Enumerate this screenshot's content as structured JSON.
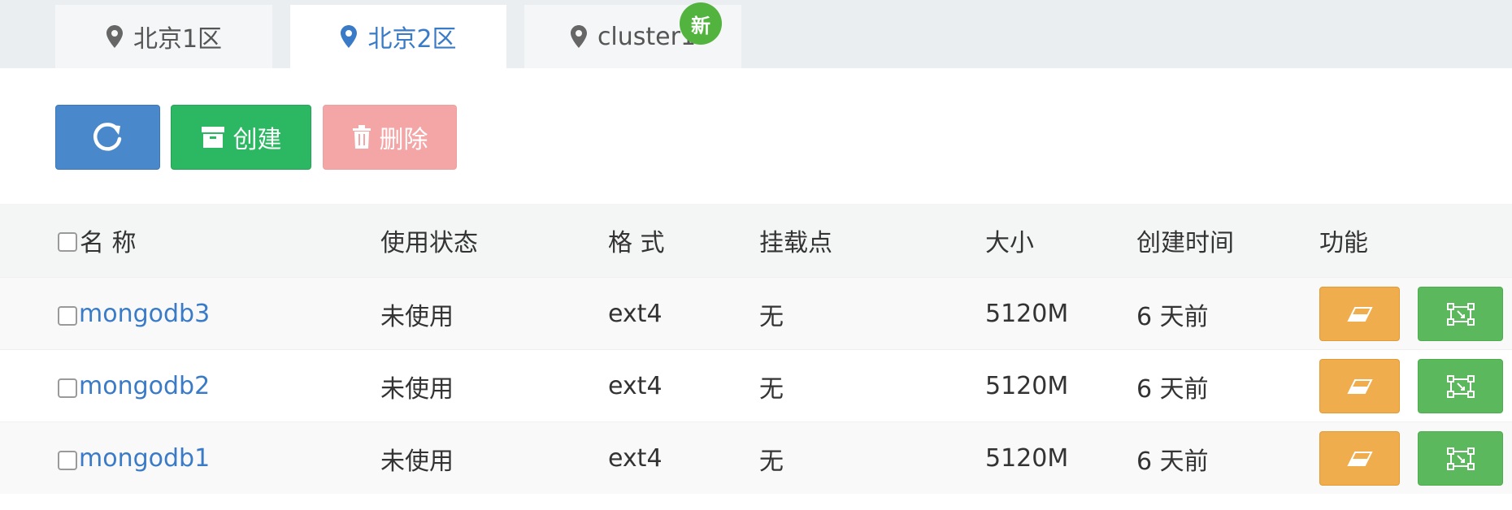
{
  "tabs": [
    {
      "label": "北京1区",
      "active": false
    },
    {
      "label": "北京2区",
      "active": true
    },
    {
      "label": "cluster1",
      "active": false,
      "badge": "新"
    }
  ],
  "toolbar": {
    "refresh_icon": "refresh-icon",
    "create_label": "创建",
    "create_icon": "archive-icon",
    "delete_label": "删除",
    "delete_icon": "trash-icon"
  },
  "table": {
    "headers": [
      "名 称",
      "使用状态",
      "格 式",
      "挂载点",
      "大小",
      "创建时间",
      "功能"
    ],
    "rows": [
      {
        "name": "mongodb3",
        "status": "未使用",
        "format": "ext4",
        "mount": "无",
        "size": "5120M",
        "created": "6 天前"
      },
      {
        "name": "mongodb2",
        "status": "未使用",
        "format": "ext4",
        "mount": "无",
        "size": "5120M",
        "created": "6 天前"
      },
      {
        "name": "mongodb1",
        "status": "未使用",
        "format": "ext4",
        "mount": "无",
        "size": "5120M",
        "created": "6 天前"
      }
    ]
  },
  "colors": {
    "primary": "#4a88cc",
    "success": "#2cb862",
    "danger_disabled": "#f4a6a6",
    "warning": "#f0ad4e",
    "link": "#3a7bc8",
    "badge": "#52b43e"
  }
}
